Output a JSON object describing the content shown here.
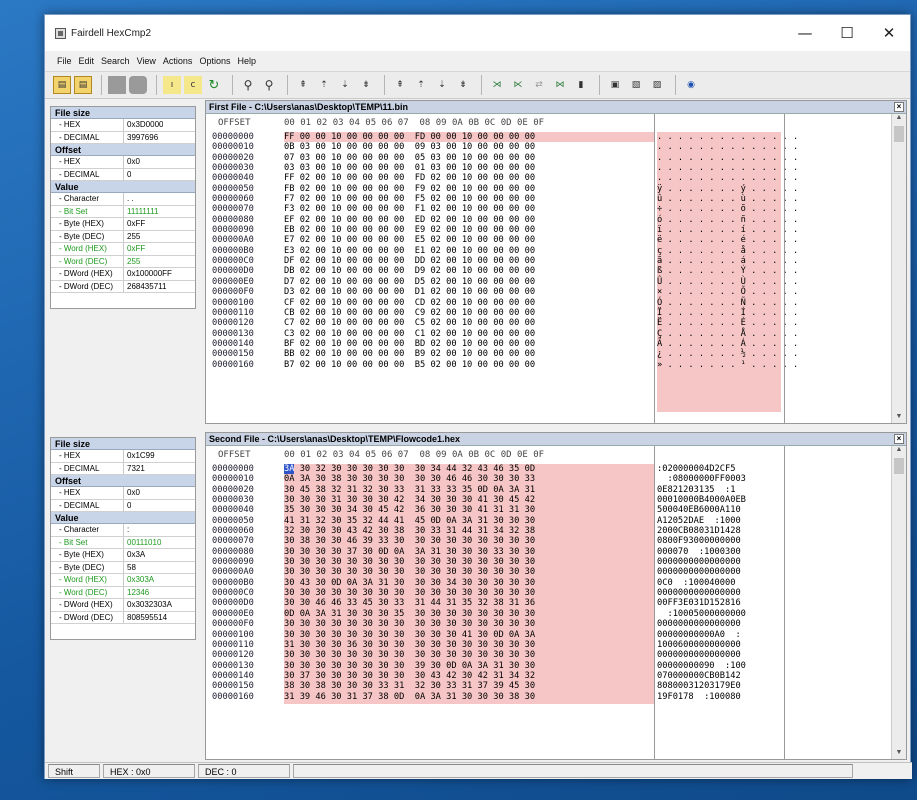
{
  "window": {
    "title": "Fairdell HexCmp2",
    "minimize_glyph": "—",
    "maximize_glyph": "☐",
    "close_glyph": "✕"
  },
  "menu": [
    "File",
    "Edit",
    "Search",
    "View",
    "Actions",
    "Options",
    "Help"
  ],
  "toolbar_icons": [
    "open-icon",
    "open2-icon",
    "save-icon",
    "save2-icon",
    "lower-icon",
    "upper-icon",
    "refresh-icon",
    "find-icon",
    "find-next-icon",
    "nav1-icon",
    "nav2-icon",
    "nav3-icon",
    "nav4-icon",
    "nav5-icon",
    "nav6-icon",
    "nav7-icon",
    "nav8-icon",
    "diff1-icon",
    "diff2-icon",
    "diff3-icon",
    "diff4-icon",
    "diff5-icon",
    "view1-icon",
    "view2-icon",
    "view3-icon",
    "help-icon"
  ],
  "side1": {
    "file_size_header": "File size",
    "hex_label": "- HEX",
    "hex_value": "0x3D0000",
    "decimal_label": "- DECIMAL",
    "decimal_value": "3997696",
    "offset_header": "Offset",
    "off_hex_label": "- HEX",
    "off_hex_value": "0x0",
    "off_dec_label": "- DECIMAL",
    "off_dec_value": "0",
    "value_header": "Value",
    "rows": [
      {
        "k": "- Character",
        "v": ". ."
      },
      {
        "k": "- Bit Set",
        "v": "11111111",
        "green": true
      },
      {
        "k": "- Byte (HEX)",
        "v": "0xFF"
      },
      {
        "k": "- Byte (DEC)",
        "v": "255"
      },
      {
        "k": "- Word (HEX)",
        "v": "0xFF",
        "green": true
      },
      {
        "k": "- Word (DEC)",
        "v": "255",
        "green": true
      },
      {
        "k": "- DWord (HEX)",
        "v": "0x100000FF"
      },
      {
        "k": "- DWord (DEC)",
        "v": "268435711"
      }
    ]
  },
  "side2": {
    "file_size_header": "File size",
    "hex_label": "- HEX",
    "hex_value": "0x1C99",
    "decimal_label": "- DECIMAL",
    "decimal_value": "7321",
    "offset_header": "Offset",
    "off_hex_label": "- HEX",
    "off_hex_value": "0x0",
    "off_dec_label": "- DECIMAL",
    "off_dec_value": "0",
    "value_header": "Value",
    "rows": [
      {
        "k": "- Character",
        "v": ":"
      },
      {
        "k": "- Bit Set",
        "v": "00111010",
        "green": true
      },
      {
        "k": "- Byte (HEX)",
        "v": "0x3A"
      },
      {
        "k": "- Byte (DEC)",
        "v": "58"
      },
      {
        "k": "- Word (HEX)",
        "v": "0x303A",
        "green": true
      },
      {
        "k": "- Word (DEC)",
        "v": "12346",
        "green": true
      },
      {
        "k": "- DWord (HEX)",
        "v": "0x3032303A"
      },
      {
        "k": "- DWord (DEC)",
        "v": "808595514"
      }
    ]
  },
  "pane1": {
    "title": "First File - C:\\Users\\anas\\Desktop\\TEMP\\11.bin",
    "header_offset": "OFFSET",
    "header_cols": "00 01 02 03 04 05 06 07  08 09 0A 0B 0C 0D 0E 0F",
    "offsets": [
      "00000000",
      "00000010",
      "00000020",
      "00000030",
      "00000040",
      "00000050",
      "00000060",
      "00000070",
      "00000080",
      "00000090",
      "000000A0",
      "000000B0",
      "000000C0",
      "000000D0",
      "000000E0",
      "000000F0",
      "00000100",
      "00000110",
      "00000120",
      "00000130",
      "00000140",
      "00000150",
      "00000160"
    ],
    "hex": [
      "FF 00 00 10 00 00 00 00  FD 00 00 10 00 00 00 00",
      "0B 03 00 10 00 00 00 00  09 03 00 10 00 00 00 00",
      "07 03 00 10 00 00 00 00  05 03 00 10 00 00 00 00",
      "03 03 00 10 00 00 00 00  01 03 00 10 00 00 00 00",
      "FF 02 00 10 00 00 00 00  FD 02 00 10 00 00 00 00",
      "FB 02 00 10 00 00 00 00  F9 02 00 10 00 00 00 00",
      "F7 02 00 10 00 00 00 00  F5 02 00 10 00 00 00 00",
      "F3 02 00 10 00 00 00 00  F1 02 00 10 00 00 00 00",
      "EF 02 00 10 00 00 00 00  ED 02 00 10 00 00 00 00",
      "EB 02 00 10 00 00 00 00  E9 02 00 10 00 00 00 00",
      "E7 02 00 10 00 00 00 00  E5 02 00 10 00 00 00 00",
      "E3 02 00 10 00 00 00 00  E1 02 00 10 00 00 00 00",
      "DF 02 00 10 00 00 00 00  DD 02 00 10 00 00 00 00",
      "DB 02 00 10 00 00 00 00  D9 02 00 10 00 00 00 00",
      "D7 02 00 10 00 00 00 00  D5 02 00 10 00 00 00 00",
      "D3 02 00 10 00 00 00 00  D1 02 00 10 00 00 00 00",
      "CF 02 00 10 00 00 00 00  CD 02 00 10 00 00 00 00",
      "CB 02 00 10 00 00 00 00  C9 02 00 10 00 00 00 00",
      "C7 02 00 10 00 00 00 00  C5 02 00 10 00 00 00 00",
      "C3 02 00 10 00 00 00 00  C1 02 00 10 00 00 00 00",
      "BF 02 00 10 00 00 00 00  BD 02 00 10 00 00 00 00",
      "BB 02 00 10 00 00 00 00  B9 02 00 10 00 00 00 00",
      "B7 02 00 10 00 00 00 00  B5 02 00 10 00 00 00 00"
    ],
    "ascii": [
      ". . . . . . . . . . . . . .",
      ". . . . . . . . . . . . . .",
      ". . . . . . . . . . . . . .",
      ". . . . . . . . . . . . . .",
      ". . . . . . . . . . . . . .",
      "ÿ . . . . . . . ý . . . . .",
      "û . . . . . . . ù . . . . .",
      "÷ . . . . . . . õ . . . . .",
      "ó . . . . . . . ñ . . . . .",
      "ï . . . . . . . í . . . . .",
      "ë . . . . . . . é . . . . .",
      "ç . . . . . . . å . . . . .",
      "ã . . . . . . . á . . . . .",
      "ß . . . . . . . Ý . . . . .",
      "Û . . . . . . . Ù . . . . .",
      "× . . . . . . . Õ . . . . .",
      "Ó . . . . . . . Ñ . . . . .",
      "Ï . . . . . . . Í . . . . .",
      "Ë . . . . . . . É . . . . .",
      "Ç . . . . . . . Å . . . . .",
      "Ã . . . . . . . Á . . . . .",
      "¿ . . . . . . . ½ . . . . .",
      "» . . . . . . . ¹ . . . . ."
    ]
  },
  "pane2": {
    "title": "Second File - C:\\Users\\anas\\Desktop\\TEMP\\Flowcode1.hex",
    "header_offset": "OFFSET",
    "header_cols": "00 01 02 03 04 05 06 07  08 09 0A 0B 0C 0D 0E 0F",
    "offsets": [
      "00000000",
      "00000010",
      "00000020",
      "00000030",
      "00000040",
      "00000050",
      "00000060",
      "00000070",
      "00000080",
      "00000090",
      "000000A0",
      "000000B0",
      "000000C0",
      "000000D0",
      "000000E0",
      "000000F0",
      "00000100",
      "00000110",
      "00000120",
      "00000130",
      "00000140",
      "00000150",
      "00000160"
    ],
    "hex": [
      "3A 30 32 30 30 30 30 30  30 34 44 32 43 46 35 0D",
      "0A 3A 30 38 30 30 30 30  30 30 46 46 30 30 30 33",
      "30 45 38 32 31 32 30 33  31 33 33 35 0D 0A 3A 31",
      "30 30 30 31 30 30 30 42  34 30 30 30 41 30 45 42",
      "35 30 30 30 34 30 45 42  36 30 30 30 41 31 31 30",
      "41 31 32 30 35 32 44 41  45 0D 0A 3A 31 30 30 30",
      "32 30 30 30 43 42 30 38  30 33 31 44 31 34 32 38",
      "30 38 30 30 46 39 33 30  30 30 30 30 30 30 30 30",
      "30 30 30 30 37 30 0D 0A  3A 31 30 30 30 33 30 30",
      "30 30 30 30 30 30 30 30  30 30 30 30 30 30 30 30",
      "30 30 30 30 30 30 30 30  30 30 30 30 30 30 30 30",
      "30 43 30 0D 0A 3A 31 30  30 30 34 30 30 30 30 30",
      "30 30 30 30 30 30 30 30  30 30 30 30 30 30 30 30",
      "30 30 46 46 33 45 30 33  31 44 31 35 32 38 31 36",
      "0D 0A 3A 31 30 30 30 35  30 30 30 30 30 30 30 30",
      "30 30 30 30 30 30 30 30  30 30 30 30 30 30 30 30",
      "30 30 30 30 30 30 30 30  30 30 30 41 30 0D 0A 3A",
      "31 30 30 30 36 30 30 30  30 30 30 30 30 30 30 30",
      "30 30 30 30 30 30 30 30  30 30 30 30 30 30 30 30",
      "30 30 30 30 30 30 30 30  39 30 0D 0A 3A 31 30 30",
      "30 37 30 30 30 30 30 30  30 43 42 30 42 31 34 32",
      "38 30 38 30 30 30 33 31  32 30 33 31 37 39 45 30",
      "31 39 46 30 31 37 38 0D  0A 3A 31 30 30 30 38 30"
    ],
    "ascii": [
      ":020000004D2CF5",
      "  :08000000FF0003",
      "0E821203135  :1",
      "00010000B4000A0EB",
      "500040EB6000A110",
      "A12052DAE  :1000",
      "2000CB08031D1428",
      "0800F93000000000",
      "000070  :1000300",
      "0000000000000000",
      "0000000000000000",
      "0C0  :100040000",
      "0000000000000000",
      "00FF3E031D152816",
      "  :10005000000000",
      "0000000000000000",
      "00000000000A0  :",
      "1000600000000000",
      "0000000000000000",
      "00000000090  :100",
      "070000000CB0B142",
      "80800031203179E0",
      "19F0178  :100080"
    ]
  },
  "status": {
    "shift": "Shift",
    "hex": "HEX : 0x0",
    "dec": "DEC : 0"
  }
}
